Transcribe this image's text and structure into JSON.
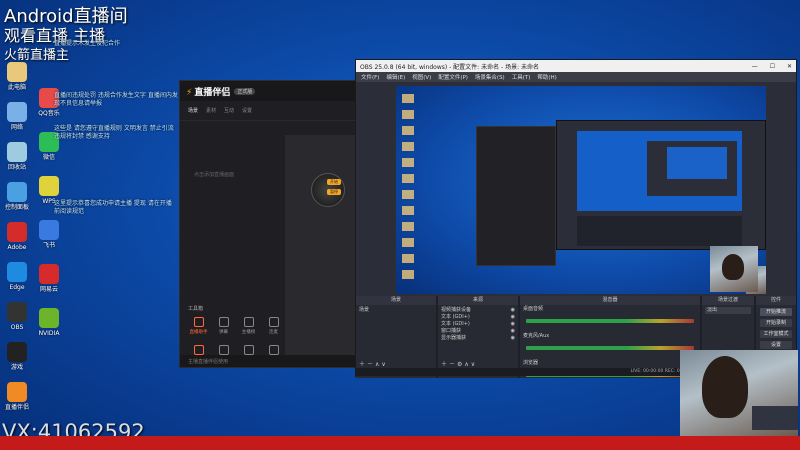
{
  "overlay": {
    "top_title": "Android直播间",
    "top_sub": "观看直播 主播",
    "left_red": "火箭直播主",
    "watermark": "VX:41062592",
    "danmu_1": "直播提示木发生侵犯合作",
    "danmu_2": "直播间违规处罚 违规合作发生文字 直播间内发现不良信息请举报",
    "danmu_3": "这些是 请您遵守直播规则 文明发言 禁止引流 违规将封禁 感谢支持",
    "danmu_4": "这里提示恭喜您成功申请主播 提现 请在开播前阅读规范"
  },
  "desktop_icons": [
    {
      "label": "此电脑",
      "color": "#e8c87a"
    },
    {
      "label": "网络",
      "color": "#7ab0e8"
    },
    {
      "label": "回收站",
      "color": "#9ecbe0"
    },
    {
      "label": "控制面板",
      "color": "#4aa0e0"
    },
    {
      "label": "Adobe",
      "color": "#d42b2b"
    },
    {
      "label": "Edge",
      "color": "#1e8ae0"
    },
    {
      "label": "OBS",
      "color": "#333333"
    },
    {
      "label": "游戏",
      "color": "#222222"
    },
    {
      "label": "直播伴侣",
      "color": "#f08a24"
    },
    {
      "label": "QQ音乐",
      "color": "#e84a4a"
    },
    {
      "label": "微信",
      "color": "#2dbd56"
    },
    {
      "label": "WPS",
      "color": "#e0d23a"
    },
    {
      "label": "飞书",
      "color": "#3a7ae0"
    },
    {
      "label": "网易云",
      "color": "#d62b2b"
    },
    {
      "label": "NVIDIA",
      "color": "#6cb52a"
    }
  ],
  "zb_window": {
    "logo": "直播伴侣",
    "badge": "正式版",
    "tabs": [
      "场景",
      "素材",
      "互动",
      "设置"
    ],
    "hint": "点击添加直播画面",
    "tools_head": "工具箱",
    "tools": [
      "直播助手",
      "弹幕",
      "主播榜",
      "连麦",
      "高级",
      "美颜",
      "音效",
      "更多"
    ],
    "footer": "主播直播伴侣使用",
    "preview_btn_1": "开始",
    "preview_btn_2": "暂停"
  },
  "obs": {
    "title": "OBS 25.0.8 (64 bit, windows) - 配置文件: 未命名 - 场景: 未命名",
    "menu": [
      "文件(F)",
      "编辑(E)",
      "视图(V)",
      "配置文件(P)",
      "场景集合(S)",
      "工具(T)",
      "帮助(H)"
    ],
    "docks": {
      "scenes": "场景",
      "sources": "来源",
      "mixer": "混音器",
      "transitions": "场景过渡",
      "controls": "控件"
    },
    "scene_item": "场景",
    "sources": [
      "视频捕获设备",
      "文本 (GDI+)",
      "文本 (GDI+)",
      "窗口捕获",
      "显示器捕获"
    ],
    "mixer": [
      "桌面音频",
      "麦克风/Aux",
      "浏览器"
    ],
    "transition": "淡出",
    "controls": [
      "开始推流",
      "开始录制",
      "工作室模式",
      "设置",
      "退出"
    ],
    "status": "LIVE: 00:00:00  REC: 00:00:00  CPU: 3.2%, 30.00 fps"
  }
}
